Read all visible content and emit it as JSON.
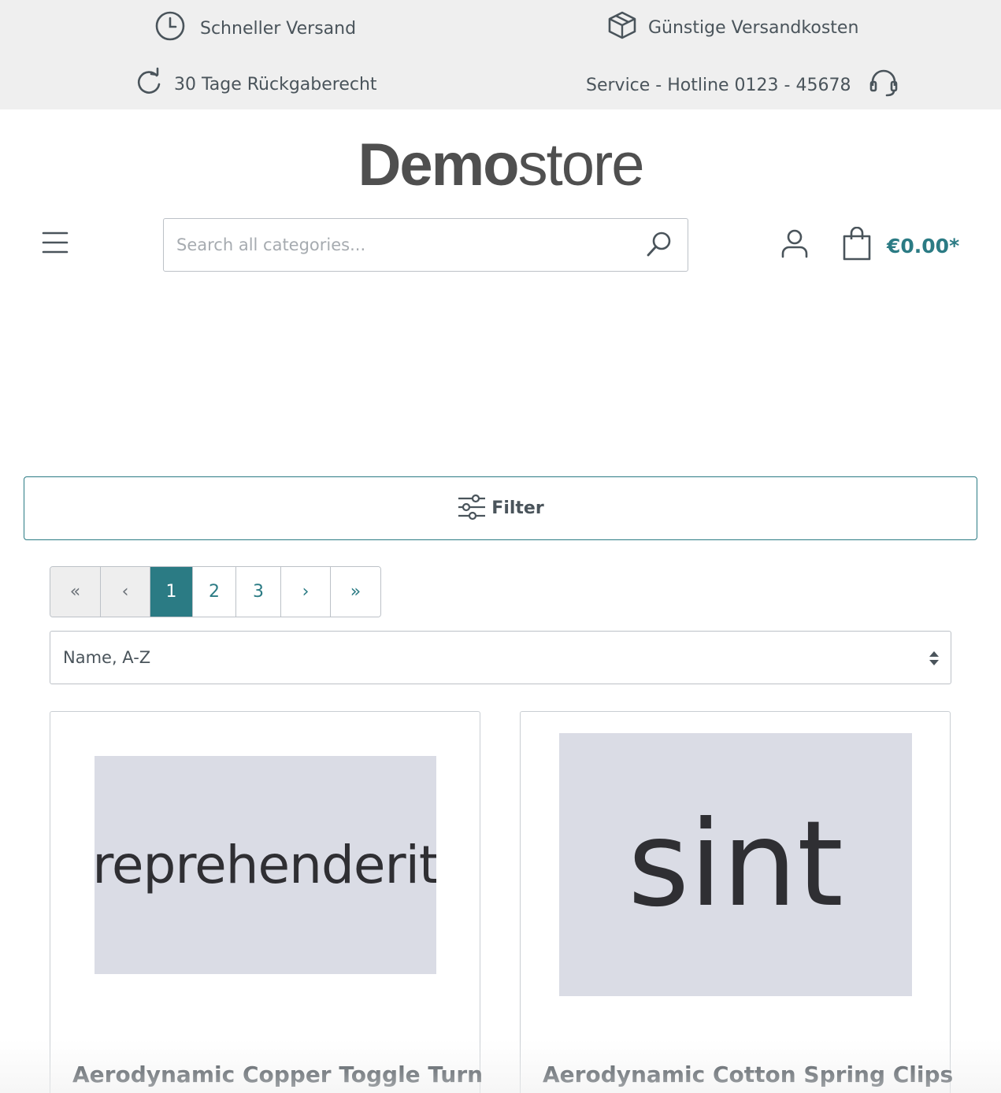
{
  "usp": {
    "shipping": "Schneller Versand",
    "costs": "Günstige Versandkosten",
    "returns": "30 Tage Rückgaberecht",
    "hotline": "Service - Hotline 0123 - 45678"
  },
  "logo": {
    "bold": "Demo",
    "light": "store"
  },
  "search": {
    "placeholder": "Search all categories..."
  },
  "cart": {
    "total": "€0.00*"
  },
  "filter": {
    "label": "Filter"
  },
  "pagination": {
    "first": "«",
    "prev": "‹",
    "pages": [
      "1",
      "2",
      "3"
    ],
    "current": "1",
    "next": "›",
    "last": "»"
  },
  "sort": {
    "selected": "Name, A-Z"
  },
  "products": [
    {
      "image_text": "reprehenderit",
      "name": "Aerodynamic Copper Toggle Turn"
    },
    {
      "image_text": "sint",
      "name": "Aerodynamic Cotton Spring Clips"
    }
  ],
  "colors": {
    "accent": "#2b7b84",
    "top_bar": "#efefef",
    "placeholder_image": "#dadce5"
  }
}
